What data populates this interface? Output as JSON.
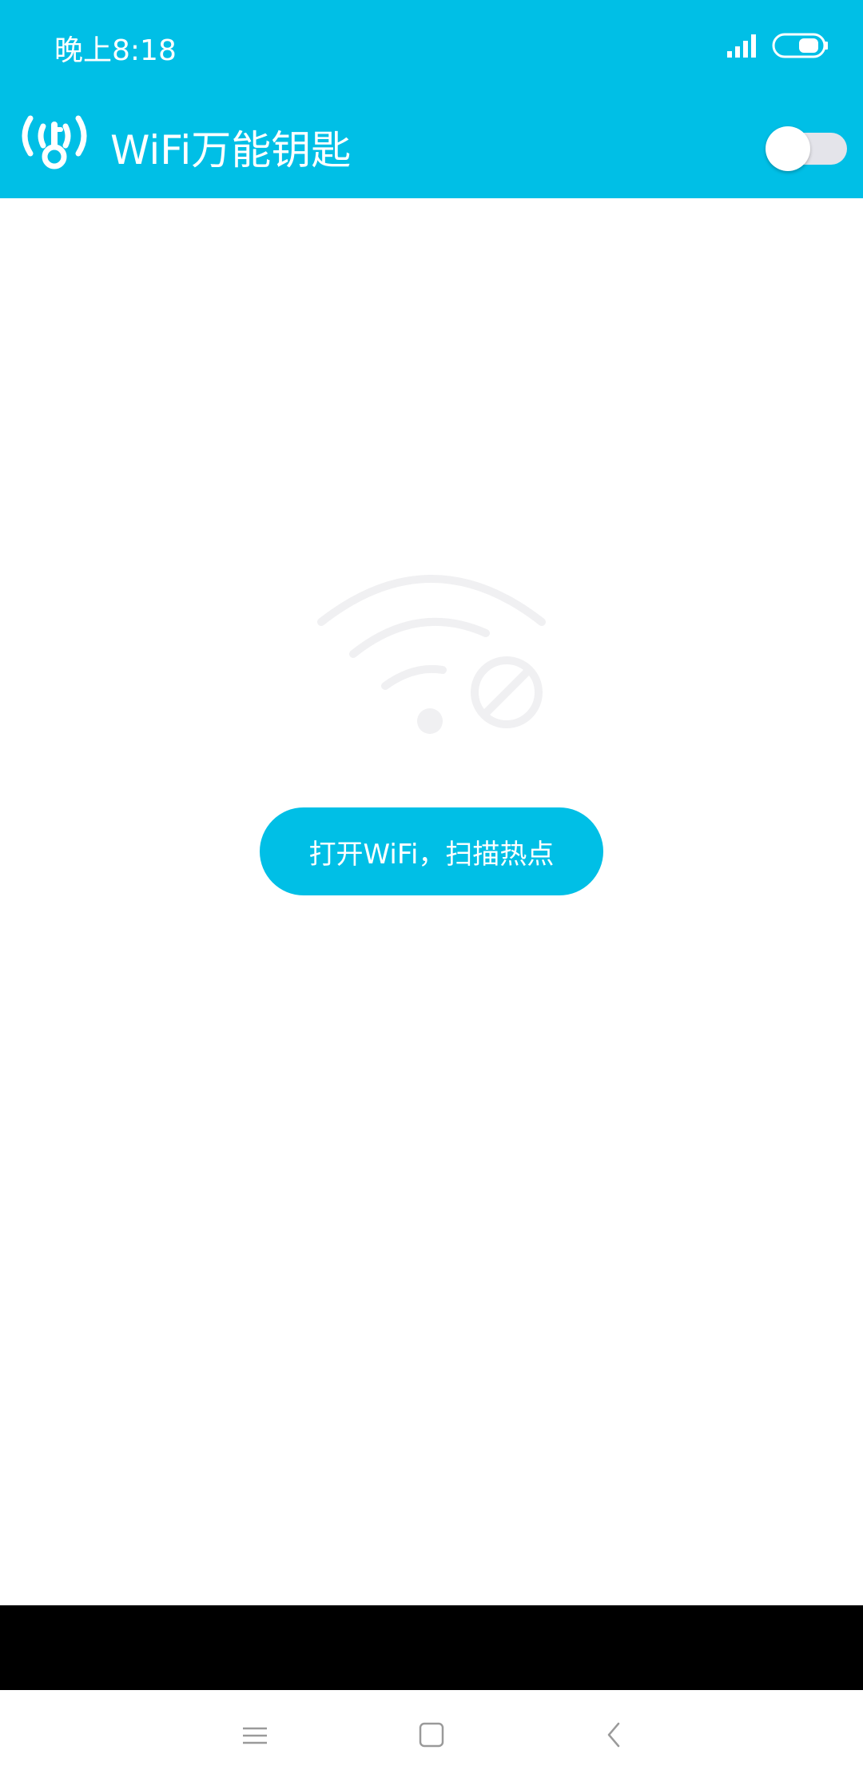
{
  "status_bar": {
    "time": "晚上8:18",
    "icons": [
      "signal-icon",
      "battery-icon"
    ]
  },
  "app_bar": {
    "title": "WiFi万能钥匙",
    "logo_icon": "wifi-key-logo-icon",
    "toggle_state": "off"
  },
  "main": {
    "illustration_icon": "wifi-disabled-icon",
    "scan_button_label": "打开WiFi，扫描热点"
  },
  "nav_bar": {
    "icons": [
      "menu-icon",
      "home-icon",
      "back-icon"
    ]
  },
  "colors": {
    "accent": "#00bfe6",
    "illustration": "#f0f0f2",
    "toggle_track": "#e4e4ea",
    "nav_icon": "#9a9a9a"
  }
}
